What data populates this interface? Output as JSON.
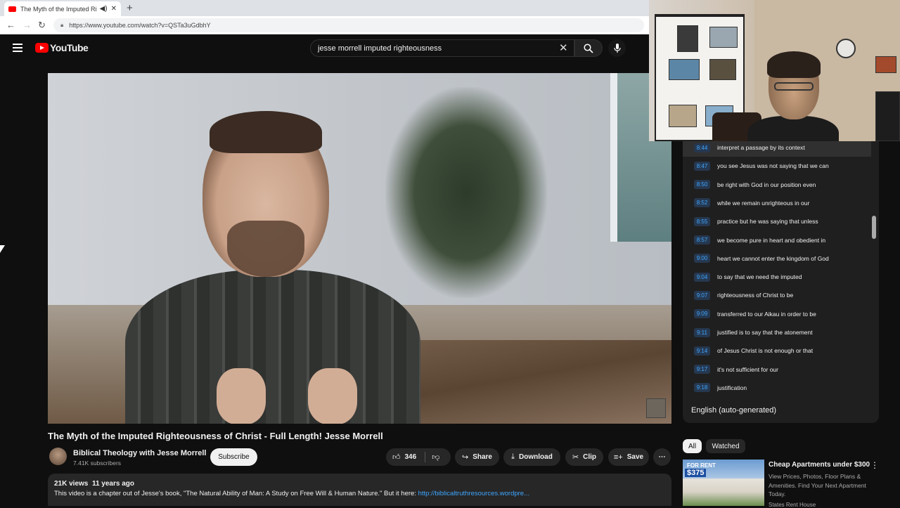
{
  "browser": {
    "tab_title": "The Myth of the Imputed Ri",
    "new_tab": "+",
    "url": "https://www.youtube.com/watch?v=QSTa3uGdbhY"
  },
  "header": {
    "logo_text": "YouTube",
    "search_value": "jesse morrell imputed righteousness"
  },
  "video": {
    "title": "The Myth of the Imputed Righteousness of Christ - Full Length! Jesse Morrell",
    "channel": "Biblical Theology with Jesse Morrell",
    "subscribers": "7.41K subscribers",
    "subscribe_label": "Subscribe",
    "likes": "346",
    "share_label": "Share",
    "download_label": "Download",
    "clip_label": "Clip",
    "save_label": "Save",
    "views": "21K views",
    "age": "11 years ago",
    "description": "This video is a chapter out of Jesse's book, \"The Natural Ability of Man: A Study on Free Will & Human Nature.\" But it here: ",
    "description_link": "http://biblicaltruthresources.wordpre..."
  },
  "transcript": {
    "language": "English (auto-generated)",
    "rows": [
      {
        "time": "8:44",
        "text": "interpret a passage by its context"
      },
      {
        "time": "8:47",
        "text": "you see Jesus was not saying that we can"
      },
      {
        "time": "8:50",
        "text": "be right with God in our position even"
      },
      {
        "time": "8:52",
        "text": "while we remain unrighteous in our"
      },
      {
        "time": "8:55",
        "text": "practice but he was saying that unless"
      },
      {
        "time": "8:57",
        "text": "we become pure in heart and obedient in"
      },
      {
        "time": "9:00",
        "text": "heart we cannot enter the kingdom of God"
      },
      {
        "time": "9:04",
        "text": "to say that we need the imputed"
      },
      {
        "time": "9:07",
        "text": "righteousness of Christ to be"
      },
      {
        "time": "9:09",
        "text": "transferred to our Aikau in order to be"
      },
      {
        "time": "9:11",
        "text": "justified is to say that the atonement"
      },
      {
        "time": "9:14",
        "text": "of Jesus Christ is not enough or that"
      },
      {
        "time": "9:17",
        "text": "it's not sufficient for our"
      },
      {
        "time": "9:18",
        "text": "justification"
      }
    ]
  },
  "chips": {
    "all": "All",
    "watched": "Watched"
  },
  "ad": {
    "badge_text": "FOR RENT",
    "price": "$375",
    "title": "Cheap Apartments under $300",
    "description": "View Prices, Photos, Floor Plans & Amenities. Find Your Next Apartment Today.",
    "sponsor": "States Rent House"
  },
  "colors": {
    "background": "#0f0f0f",
    "brand_red": "#ff0000",
    "link_blue": "#3ea6ff",
    "pill_bg": "#272727"
  },
  "icons": [
    "menu-icon",
    "search-icon",
    "mic-icon",
    "clear-icon",
    "like-icon",
    "dislike-icon",
    "share-icon",
    "download-icon",
    "clip-icon",
    "save-icon",
    "more-icon"
  ]
}
